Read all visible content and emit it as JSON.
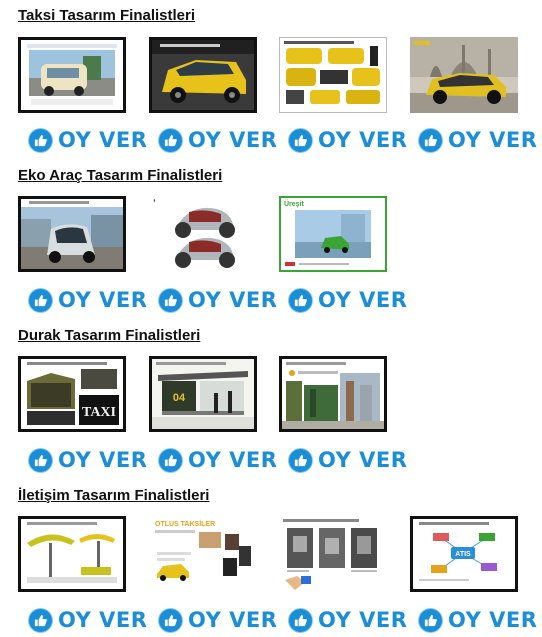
{
  "sections": [
    {
      "title": "Taksi Tasarım Finalistleri"
    },
    {
      "title": "Eko Araç Tasarım Finalistleri"
    },
    {
      "title": "Durak Tasarım Finalistleri"
    },
    {
      "title": "İletişim Tasarım Finalistleri"
    }
  ],
  "thumbs": {
    "eko_2_mark": "’",
    "eko_3_logo": "Üreşit",
    "durak_1_sign": "TAXI",
    "durak_2_text": "04",
    "iletisim_2_heading": "OTLUS TAKSİLER",
    "iletisim_4_center": "ATIS"
  },
  "vote": {
    "label": "OY VER",
    "icon": "thumbs-up-icon",
    "color": "#1a8fd8"
  },
  "colors": {
    "taxi_yellow": "#e6c21a",
    "frame_green": "#3aa535"
  }
}
